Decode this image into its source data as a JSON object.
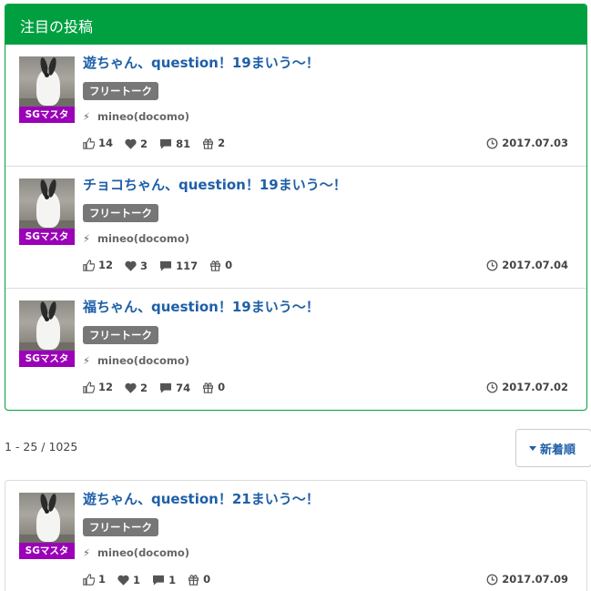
{
  "featured": {
    "title": "注目の投稿",
    "posts": [
      {
        "title": "遊ちゃん、question！19まいう～！",
        "badge": "SGマスタ",
        "category": "フリートーク",
        "carrier": "mineo(docomo)",
        "likes": "14",
        "hearts": "2",
        "comments": "81",
        "gifts": "2",
        "date": "2017.07.03"
      },
      {
        "title": "チョコちゃん、question！19まいう～！",
        "badge": "SGマスタ",
        "category": "フリートーク",
        "carrier": "mineo(docomo)",
        "likes": "12",
        "hearts": "3",
        "comments": "117",
        "gifts": "0",
        "date": "2017.07.04"
      },
      {
        "title": "福ちゃん、question！19まいう～！",
        "badge": "SGマスタ",
        "category": "フリートーク",
        "carrier": "mineo(docomo)",
        "likes": "12",
        "hearts": "2",
        "comments": "74",
        "gifts": "0",
        "date": "2017.07.02"
      }
    ]
  },
  "pager": {
    "count_text": "1 - 25 / 1025",
    "sort_label": "新着順"
  },
  "list": {
    "posts": [
      {
        "title": "遊ちゃん、question！21まいう～！",
        "badge": "SGマスタ",
        "category": "フリートーク",
        "carrier": "mineo(docomo)",
        "likes": "1",
        "hearts": "1",
        "comments": "1",
        "gifts": "0",
        "date": "2017.07.09"
      }
    ]
  },
  "colors": {
    "brand_green": "#00a040",
    "link_blue": "#1f5fa8",
    "badge_purple": "#9b00b8",
    "tag_gray": "#777777"
  },
  "icons": {
    "like": "thumbs-up-icon",
    "heart": "heart-icon",
    "comment": "comment-icon",
    "gift": "gift-icon",
    "clock": "clock-icon",
    "carrier": "bolt-icon",
    "sort": "caret-down-icon"
  }
}
